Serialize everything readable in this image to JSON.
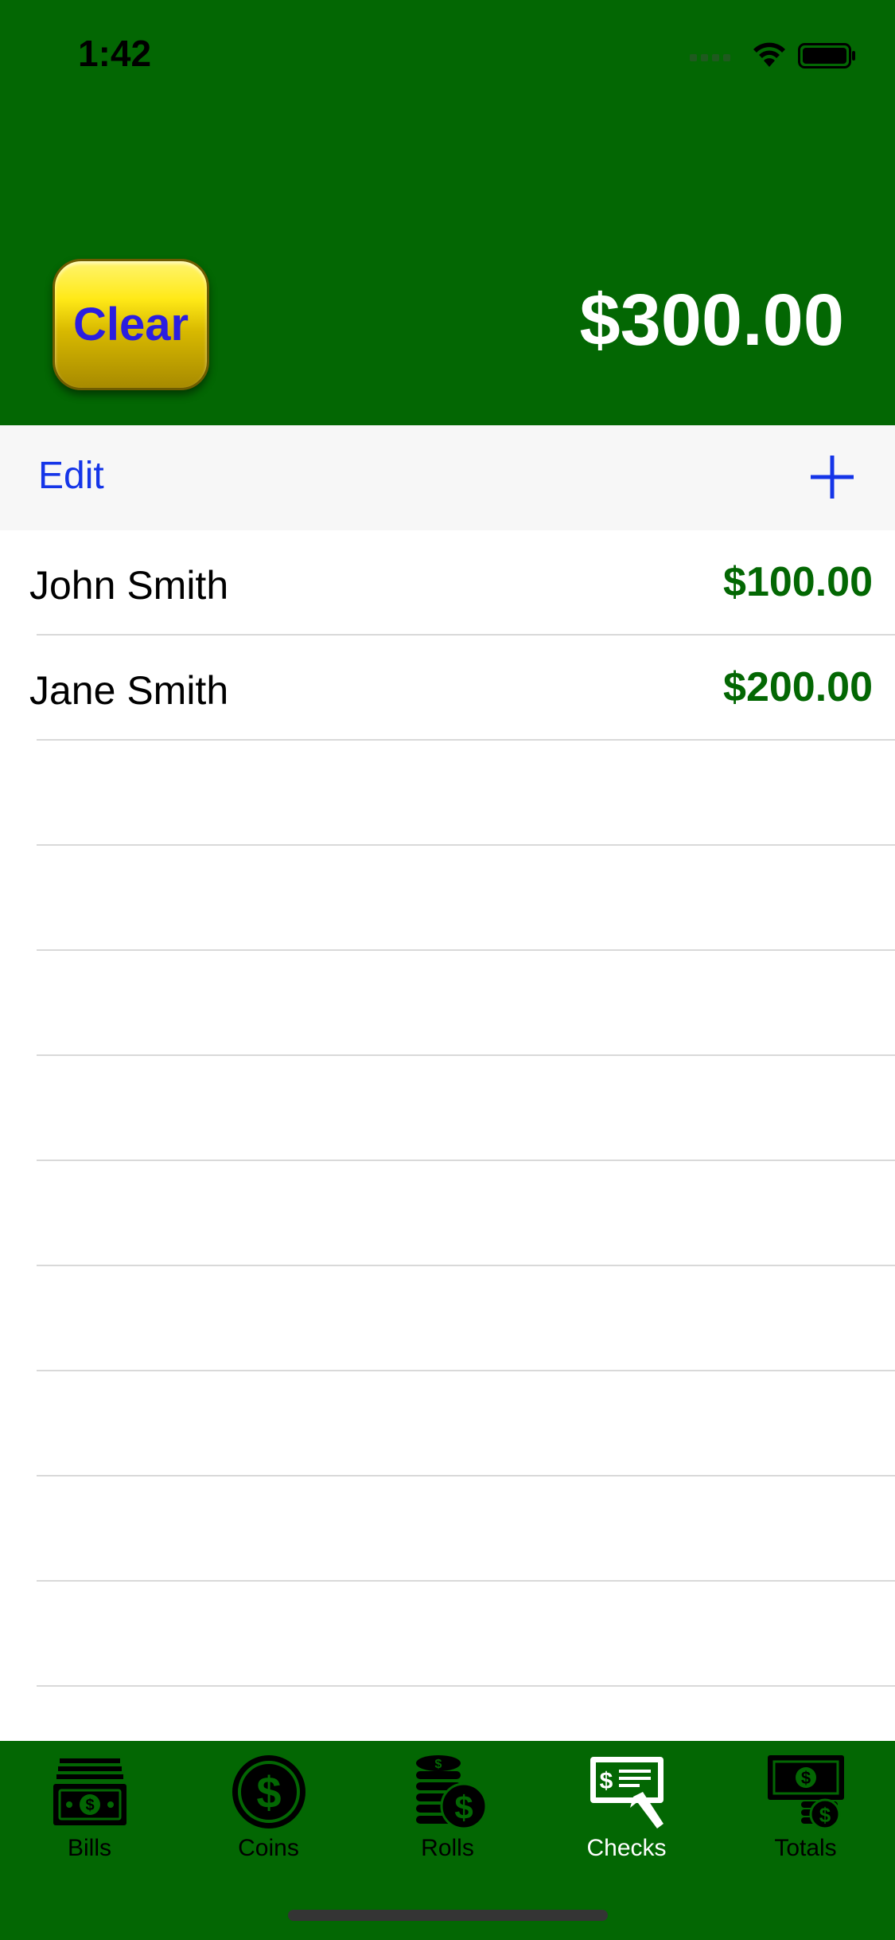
{
  "status": {
    "time": "1:42"
  },
  "header": {
    "clear_label": "Clear",
    "total": "$300.00"
  },
  "toolbar": {
    "edit_label": "Edit",
    "add_icon": "plus-icon"
  },
  "checks": [
    {
      "name": "John Smith",
      "amount": "$100.00"
    },
    {
      "name": "Jane Smith",
      "amount": "$200.00"
    }
  ],
  "tabs": [
    {
      "label": "Bills",
      "icon": "bills-icon",
      "active": false
    },
    {
      "label": "Coins",
      "icon": "coins-icon",
      "active": false
    },
    {
      "label": "Rolls",
      "icon": "rolls-icon",
      "active": false
    },
    {
      "label": "Checks",
      "icon": "checks-icon",
      "active": true
    },
    {
      "label": "Totals",
      "icon": "totals-icon",
      "active": false
    }
  ],
  "colors": {
    "header_green": "#036703",
    "amount_green": "#036703",
    "link_blue": "#1535e8",
    "clear_text": "#2b1ee0",
    "clear_gold": "#ffe917"
  }
}
